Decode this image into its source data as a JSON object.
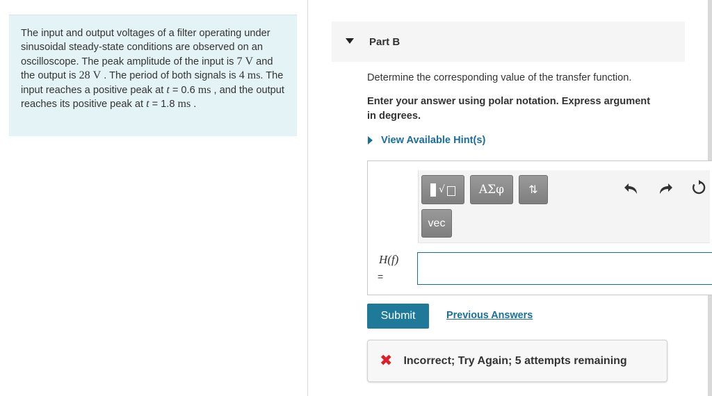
{
  "problem": {
    "t1": "The input and output voltages of a filter operating under sinusoidal steady-state conditions are observed on an oscilloscope. The peak amplitude of the input is ",
    "v_in": "7",
    "unit_v1": "V",
    "t2": " and the output is ",
    "v_out": "28",
    "unit_v2": "V",
    "t3": " . The period of both signals is ",
    "period": "4",
    "unit_ms1": "ms",
    "t4": ". The input reaches a positive peak at ",
    "t_var1": "t",
    "t5": " = 0.6 ",
    "unit_ms2": "ms",
    "t6": " , and the output reaches its positive peak at ",
    "t_var2": "t",
    "t7": " = 1.8 ",
    "unit_ms3": "ms",
    "t8": " ."
  },
  "part": {
    "title": "Part B"
  },
  "instructions": {
    "main": "Determine the corresponding value of the transfer function.",
    "bold": "Enter your answer using polar notation. Express argument in degrees."
  },
  "hints": {
    "label": "View Available Hint(s)"
  },
  "toolbar": {
    "templates_sqrt": "√",
    "greek_label": "ΑΣφ",
    "arrows_label": "⇅",
    "vec_label": "vec",
    "undo_icon": "undo-icon",
    "redo_icon": "redo-icon",
    "reset_icon": "reset-icon"
  },
  "answer": {
    "variable": "H(f)",
    "equals": "=",
    "value": ""
  },
  "buttons": {
    "submit": "Submit",
    "previous_answers": "Previous Answers"
  },
  "feedback": {
    "icon": "✖",
    "text": "Incorrect; Try Again; 5 attempts remaining"
  },
  "colors": {
    "problem_bg": "#e4f4f6",
    "link": "#1a6e9c",
    "submit_bg": "#1f7a99",
    "error": "#e01e26"
  }
}
